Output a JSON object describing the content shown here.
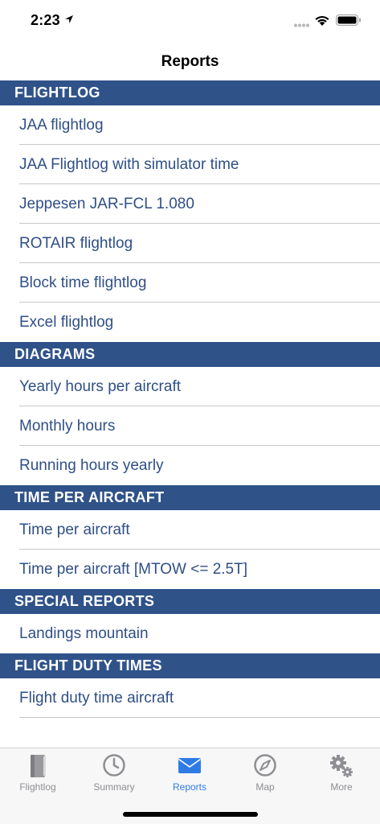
{
  "status_bar": {
    "time": "2:23"
  },
  "nav": {
    "title": "Reports"
  },
  "sections": [
    {
      "header": "FLIGHTLOG",
      "items": [
        "JAA flightlog",
        "JAA Flightlog with simulator time",
        "Jeppesen JAR-FCL 1.080",
        "ROTAIR flightlog",
        "Block time flightlog",
        "Excel flightlog"
      ]
    },
    {
      "header": "DIAGRAMS",
      "items": [
        "Yearly hours per aircraft",
        "Monthly hours",
        "Running hours yearly"
      ]
    },
    {
      "header": "TIME PER AIRCRAFT",
      "items": [
        "Time per aircraft",
        "Time per aircraft [MTOW <= 2.5T]"
      ]
    },
    {
      "header": "SPECIAL REPORTS",
      "items": [
        "Landings mountain"
      ]
    },
    {
      "header": "FLIGHT DUTY TIMES",
      "items": [
        "Flight duty time aircraft"
      ]
    }
  ],
  "tabs": [
    {
      "label": "Flightlog",
      "icon": "book-icon"
    },
    {
      "label": "Summary",
      "icon": "clock-icon"
    },
    {
      "label": "Reports",
      "icon": "envelope-icon"
    },
    {
      "label": "Map",
      "icon": "compass-icon"
    },
    {
      "label": "More",
      "icon": "gears-icon"
    }
  ],
  "colors": {
    "header_bg": "#2f5289",
    "row_text": "#2f4f86",
    "active_tab": "#2f7be6",
    "inactive_tab": "#8e8e93"
  }
}
